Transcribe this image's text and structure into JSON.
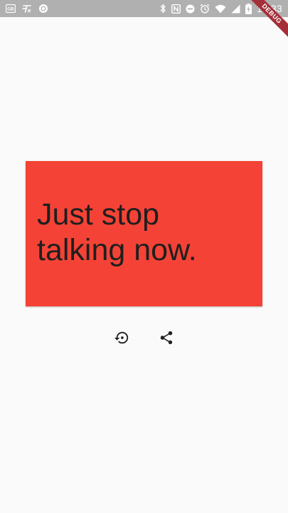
{
  "status_bar": {
    "time": "17:33",
    "left_icons": [
      "gallery-icon",
      "font-icon",
      "record-icon"
    ],
    "right_icons": [
      "bluetooth-icon",
      "nfc-icon",
      "do-not-disturb-icon",
      "alarm-icon",
      "wifi-icon",
      "signal-icon",
      "battery-charging-icon"
    ],
    "background_color": "#b0b0b0"
  },
  "debug_banner": {
    "label": "DEBUG",
    "color": "#a52f38"
  },
  "card": {
    "quote": "Just stop talking now.",
    "background_color": "#f44336",
    "text_color": "#1f1f1f"
  },
  "actions": {
    "refresh_icon": "restore-icon",
    "share_icon": "share-icon"
  }
}
